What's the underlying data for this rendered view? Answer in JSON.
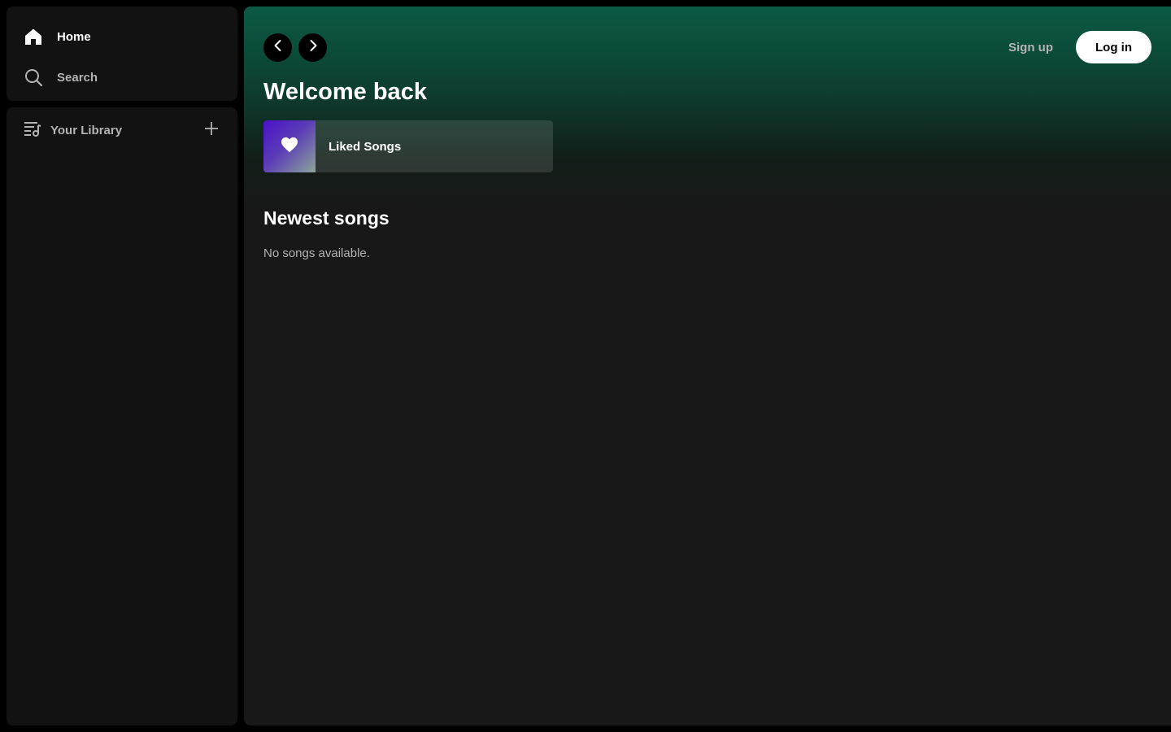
{
  "sidebar": {
    "nav": [
      {
        "label": "Home",
        "icon": "home-icon",
        "active": true
      },
      {
        "label": "Search",
        "icon": "search-icon",
        "active": false
      }
    ],
    "library": {
      "label": "Your Library",
      "icon": "library-icon",
      "add_icon": "plus-icon"
    }
  },
  "topbar": {
    "back_icon": "chevron-left-icon",
    "forward_icon": "chevron-right-icon",
    "signup_label": "Sign up",
    "login_label": "Log in"
  },
  "main": {
    "greeting": "Welcome back",
    "shortcut": {
      "label": "Liked Songs",
      "icon": "heart-icon"
    },
    "section_title": "Newest songs",
    "empty_message": "No songs available."
  },
  "colors": {
    "accent_green": "#0b5a45",
    "panel_bg": "#121212",
    "main_bg": "#181818",
    "muted_text": "#b3b3b3"
  }
}
